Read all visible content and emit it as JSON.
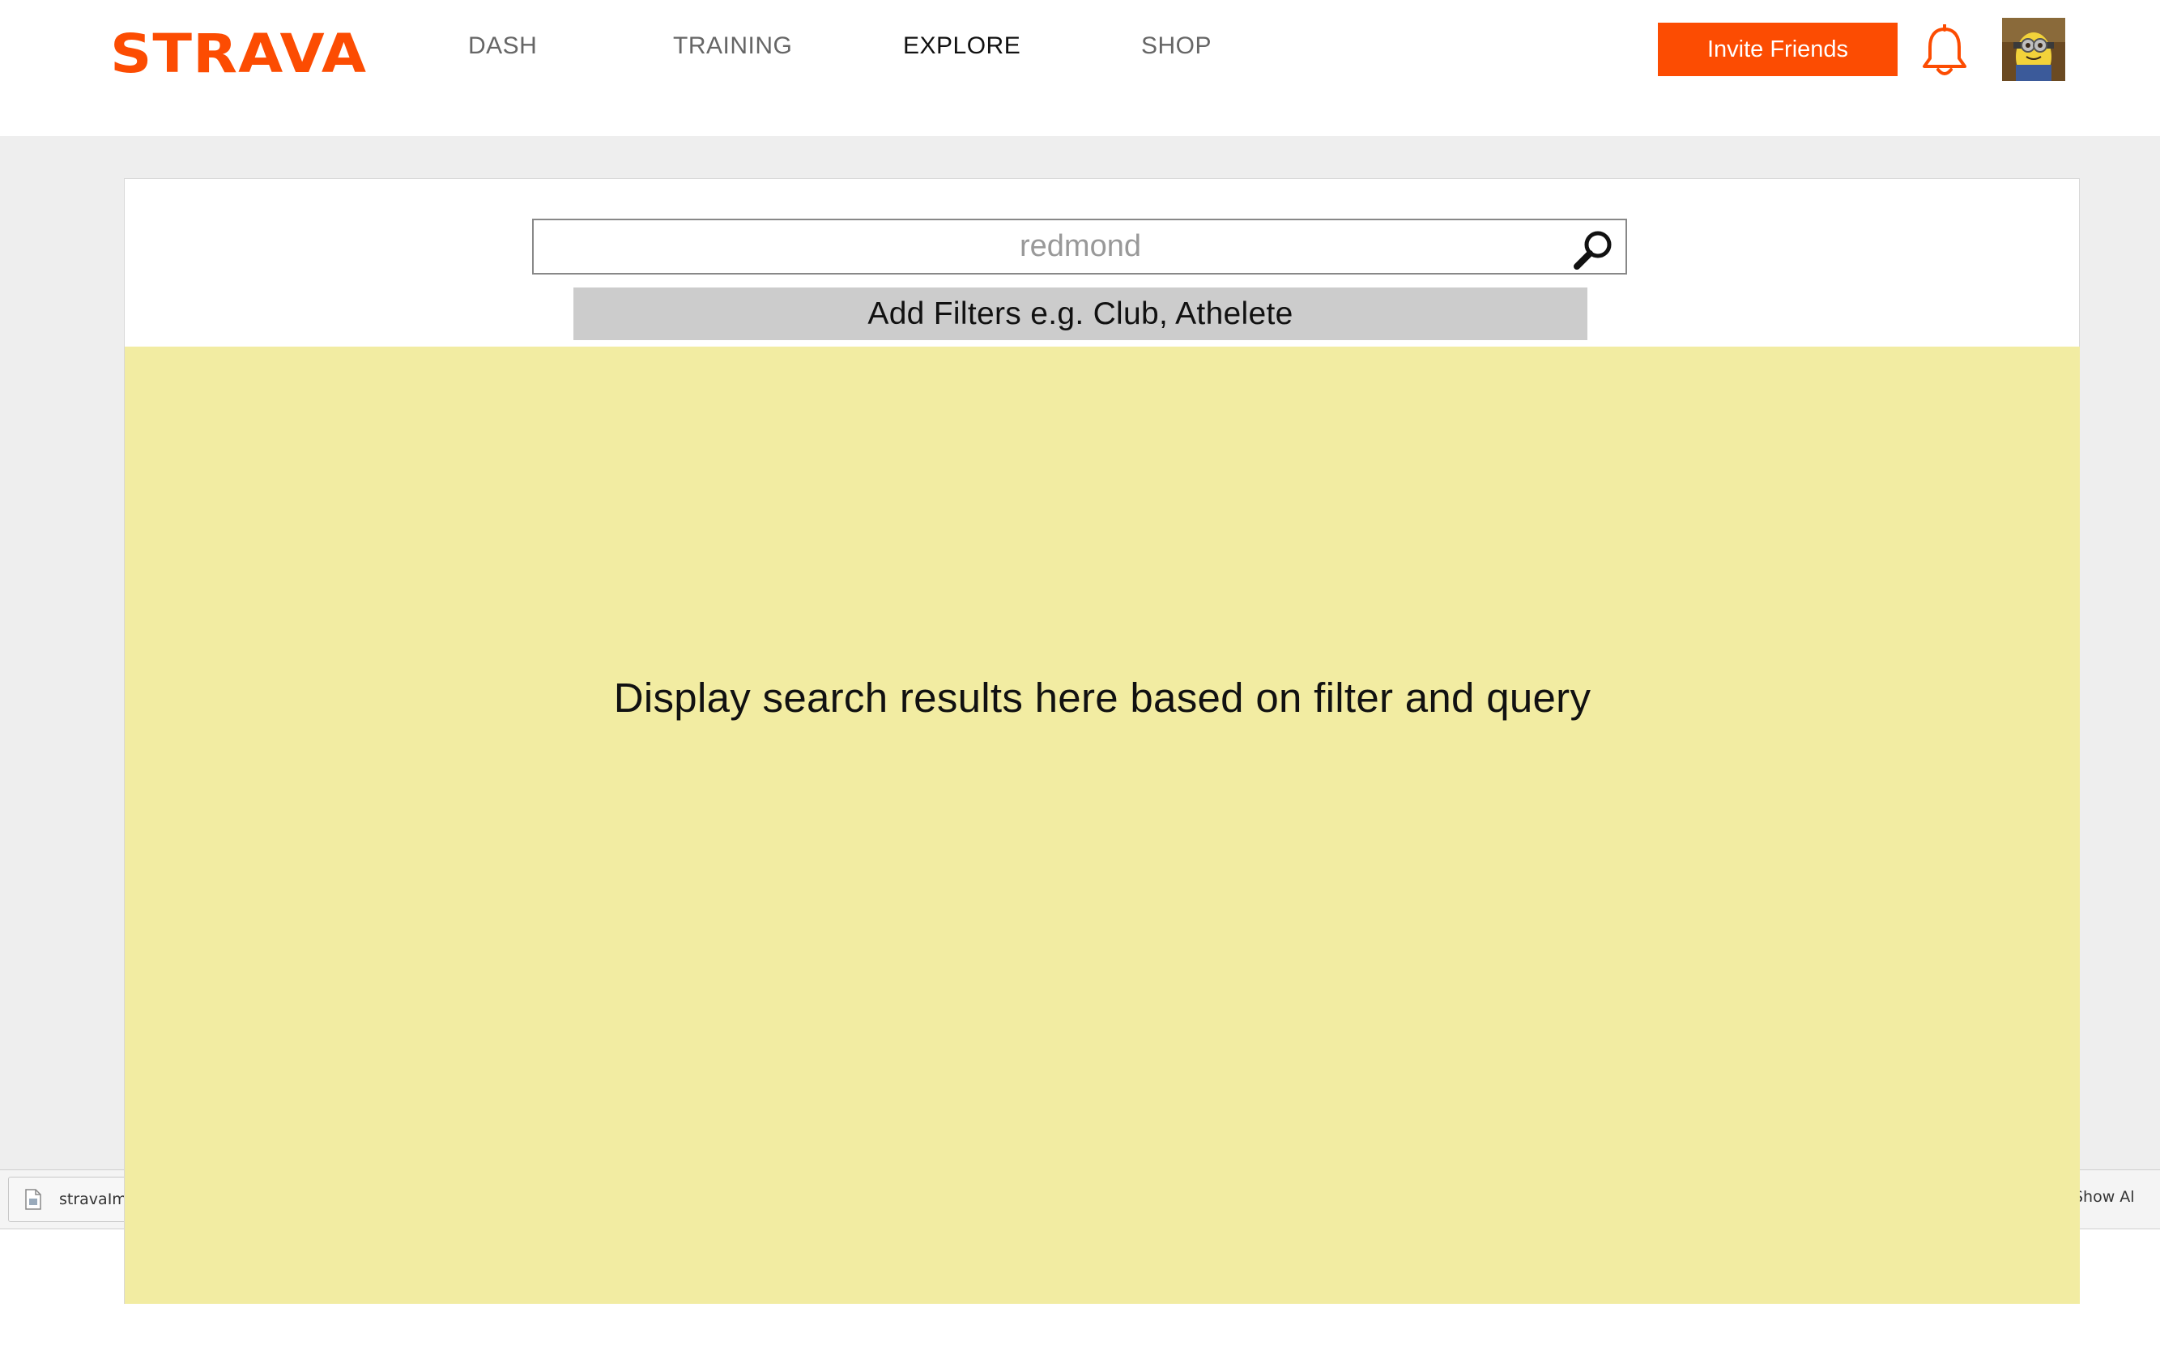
{
  "brand": {
    "logo_text": "STRAVA",
    "accent_color": "#fc4c02"
  },
  "nav": {
    "items": [
      {
        "label": "DASH",
        "active": false
      },
      {
        "label": "TRAINING",
        "active": false
      },
      {
        "label": "EXPLORE",
        "active": true
      },
      {
        "label": "SHOP",
        "active": false
      }
    ],
    "invite_label": "Invite Friends",
    "notification_icon": "bell-icon",
    "avatar_icon": "avatar"
  },
  "search": {
    "placeholder": "redmond",
    "icon": "search-icon"
  },
  "filters": {
    "label": "Add Filters e.g. Club, Athelete"
  },
  "results": {
    "message": "Display search results here based on filter and query",
    "background_color": "#f2eca2"
  },
  "download_bar": {
    "file_name": "stravaIm",
    "show_all_label": "Show Al",
    "file_icon": "file-icon"
  }
}
